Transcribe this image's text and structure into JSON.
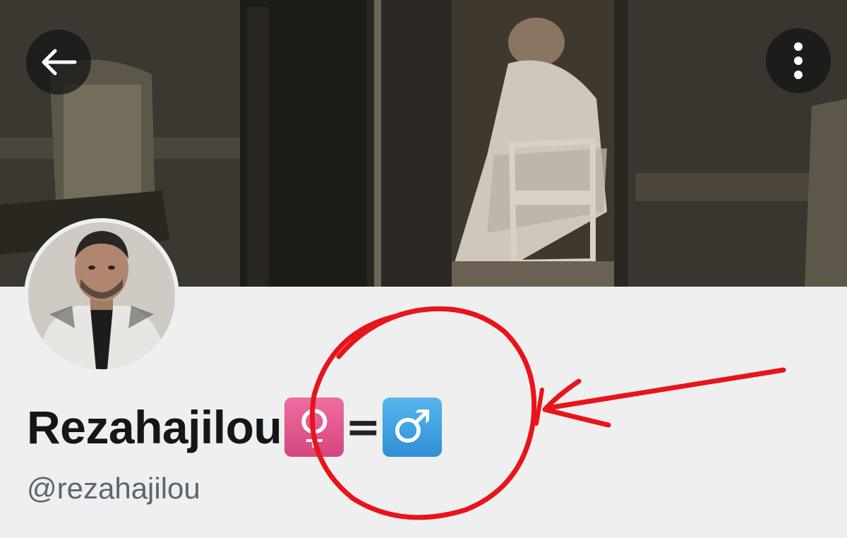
{
  "header": {
    "back_icon": "arrow-left-icon",
    "more_icon": "more-vertical-icon"
  },
  "profile": {
    "display_name": "Rezahajilou",
    "name_emoji": {
      "female_symbol": "♀",
      "equals": "=",
      "male_symbol": "♂"
    },
    "handle": "@rezahajilou"
  },
  "colors": {
    "female_box": "#e0578c",
    "male_box": "#3d9fe0",
    "annotation_red": "#e8141b",
    "handle_text": "#5b6670"
  }
}
